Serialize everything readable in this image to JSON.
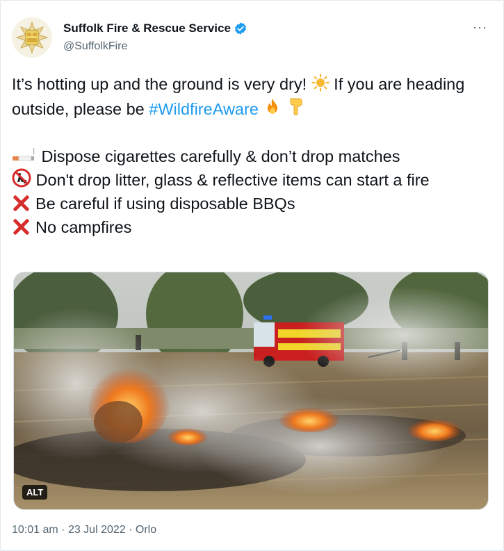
{
  "account": {
    "display_name": "Suffolk Fire & Rescue Service",
    "handle": "@SuffolkFire",
    "verified": true
  },
  "more_label": "···",
  "tweet": {
    "line1_a": "It’s hotting up and the ground is very dry! ",
    "line1_b": " If you are heading outside, please be ",
    "hashtag": "#WildfireAware",
    "bullet1": " Dispose cigarettes carefully & don’t drop matches",
    "bullet2": " Don't drop litter, glass & reflective items can start a fire",
    "bullet3": "Be careful if using disposable BBQs",
    "bullet4": "No campfires"
  },
  "media": {
    "alt_label": "ALT"
  },
  "meta": {
    "time": "10:01 am",
    "date": "23 Jul 2022",
    "source": "Orlo",
    "separator": " · "
  },
  "icons": [
    "verified-badge-icon",
    "sun-icon",
    "fire-icon",
    "pointing-down-icon",
    "cigarette-icon",
    "no-littering-icon",
    "cross-mark-icon"
  ],
  "colors": {
    "link": "#1d9bf0",
    "verified": "#1d9bf0",
    "cross": "#d62c2c",
    "secondary_text": "#536471"
  }
}
